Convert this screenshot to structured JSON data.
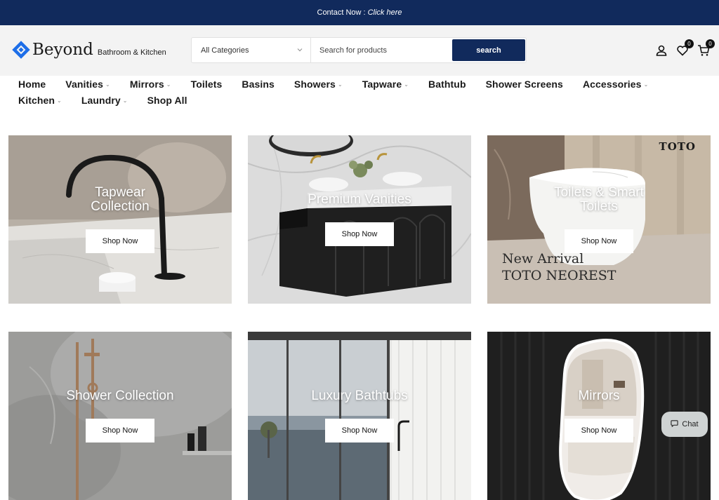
{
  "topbar": {
    "contact_label": "Contact Now :",
    "contact_link": "Click here"
  },
  "header": {
    "logo_word": "Beyond",
    "logo_sub": "Bathroom & Kitchen",
    "category_selected": "All Categories",
    "search_placeholder": "Search for products",
    "search_button": "search",
    "wishlist_count": "0",
    "cart_count": "0"
  },
  "nav": {
    "items": [
      {
        "label": "Home"
      },
      {
        "label": "Vanities"
      },
      {
        "label": "Mirrors"
      },
      {
        "label": "Toilets"
      },
      {
        "label": "Basins"
      },
      {
        "label": "Showers"
      },
      {
        "label": "Tapware"
      },
      {
        "label": "Bathtub"
      },
      {
        "label": "Shower Screens"
      },
      {
        "label": "Accessories"
      },
      {
        "label": "Kitchen"
      },
      {
        "label": "Laundry"
      },
      {
        "label": "Shop All"
      }
    ]
  },
  "tiles": [
    {
      "title_line1": "Tapwear",
      "title_line2": "Collection",
      "button": "Shop Now"
    },
    {
      "title_line1": "Premium Vanities",
      "button": "Shop Now"
    },
    {
      "title_line1": "Toilets & Smart",
      "title_line2": "Toilets",
      "button": "Shop Now",
      "overlay_line1": "New Arrival",
      "overlay_line2": "TOTO NEOREST",
      "brand": "TOTO"
    },
    {
      "title_line1": "Shower Collection",
      "button": "Shop Now"
    },
    {
      "title_line1": "Luxury Bathtubs",
      "button": "Shop Now"
    },
    {
      "title_line1": "Mirrors",
      "button": "Shop Now"
    }
  ],
  "chat": {
    "label": "Chat"
  },
  "colors": {
    "brand_navy": "#112a5c",
    "logo_blue": "#1d6ee8"
  }
}
